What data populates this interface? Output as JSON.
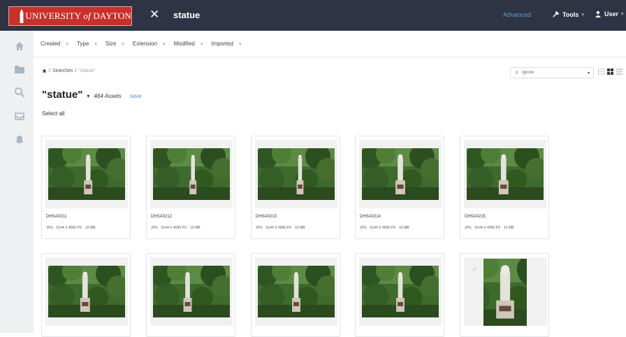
{
  "header": {
    "logo_prefix": "UNIVERSITY ",
    "logo_of": "of",
    "logo_suffix": " DAYTON",
    "search_query": "statue",
    "advanced_label": "Advanced",
    "tools_label": "Tools",
    "user_label": "User"
  },
  "filters": [
    "Created",
    "Type",
    "Size",
    "Extension",
    "Modified",
    "Imported"
  ],
  "breadcrumb": {
    "root": "Searches",
    "current": "\"statue\""
  },
  "sort": {
    "value": "Ignore"
  },
  "results": {
    "title": "\"statue\"",
    "count": "464 Assets",
    "save_label": "save",
    "select_all": "Select all"
  },
  "assets": [
    {
      "name": "DHSA0211",
      "ext": "JPG",
      "dims": "6144 X 4096 PX",
      "size": "15 MB"
    },
    {
      "name": "DHSA0212",
      "ext": "JPG",
      "dims": "6144 X 4096 PX",
      "size": "15 MB"
    },
    {
      "name": "DHSA0213",
      "ext": "JPG",
      "dims": "6144 X 4096 PX",
      "size": "15 MB"
    },
    {
      "name": "DHSA0214",
      "ext": "JPG",
      "dims": "6144 X 4096 PX",
      "size": "15 MB"
    },
    {
      "name": "DHSA0215",
      "ext": "JPG",
      "dims": "6144 X 4096 PX",
      "size": "15 MB"
    },
    {
      "name": "",
      "ext": "",
      "dims": "",
      "size": ""
    },
    {
      "name": "",
      "ext": "",
      "dims": "",
      "size": ""
    },
    {
      "name": "",
      "ext": "",
      "dims": "",
      "size": ""
    },
    {
      "name": "",
      "ext": "",
      "dims": "",
      "size": ""
    },
    {
      "name": "",
      "ext": "",
      "dims": "",
      "size": ""
    }
  ],
  "colors": {
    "topbar": "#2e3443",
    "brand_red": "#c8312b",
    "link_blue": "#4a90d9",
    "sidebar": "#eef0f2"
  },
  "icons": [
    "home-icon",
    "folder-icon",
    "search-icon",
    "inbox-icon",
    "bell-icon"
  ]
}
